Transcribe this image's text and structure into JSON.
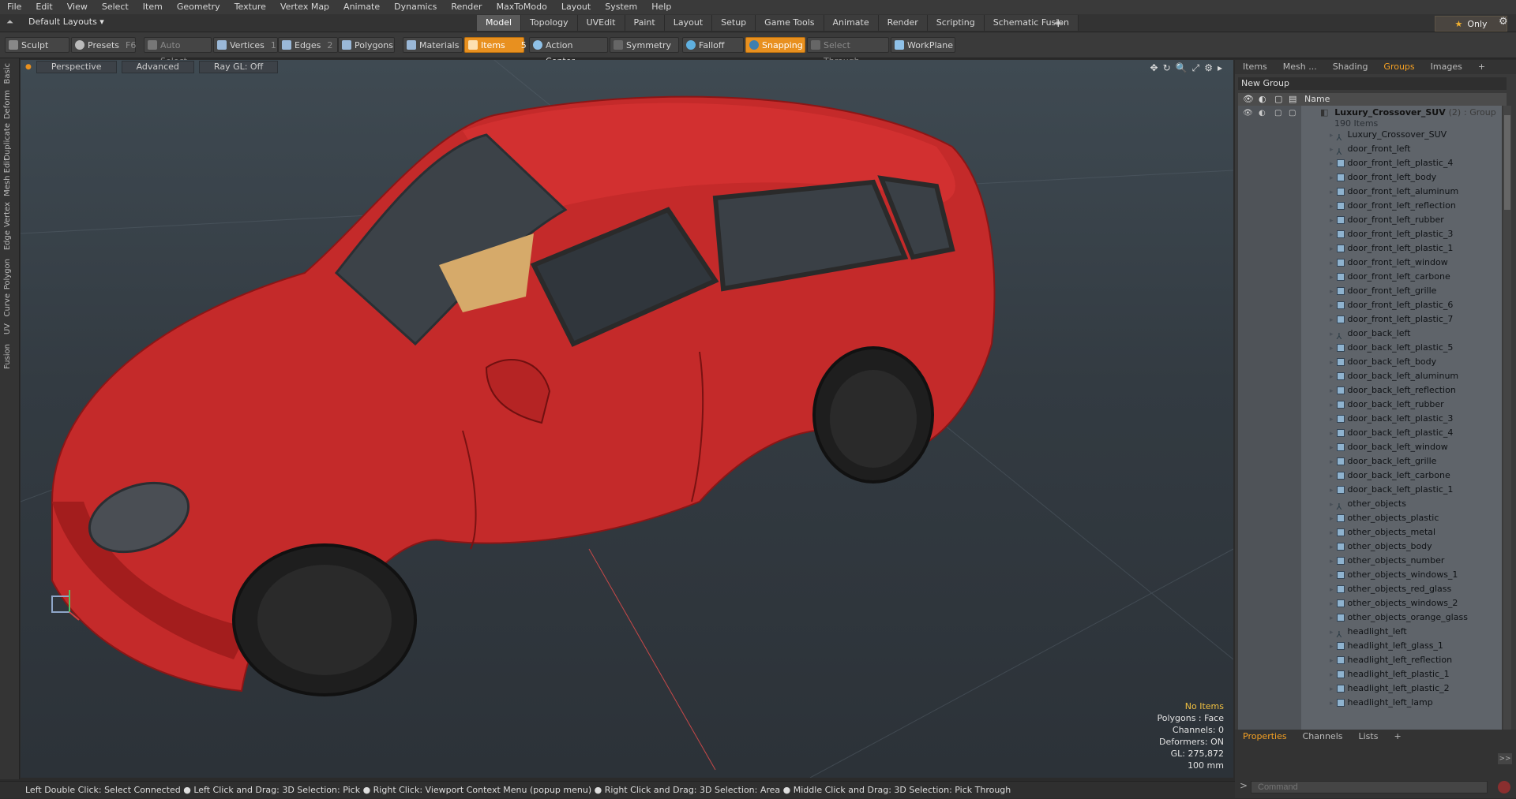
{
  "menu": [
    "File",
    "Edit",
    "View",
    "Select",
    "Item",
    "Geometry",
    "Texture",
    "Vertex Map",
    "Animate",
    "Dynamics",
    "Render",
    "MaxToModo",
    "Layout",
    "System",
    "Help"
  ],
  "layout": {
    "selector": "Default Layouts ▾"
  },
  "tabs": [
    {
      "label": "Model",
      "active": true
    },
    {
      "label": "Topology",
      "active": false
    },
    {
      "label": "UVEdit",
      "active": false
    },
    {
      "label": "Paint",
      "active": false
    },
    {
      "label": "Layout",
      "active": false
    },
    {
      "label": "Setup",
      "active": false
    },
    {
      "label": "Game Tools",
      "active": false
    },
    {
      "label": "Animate",
      "active": false
    },
    {
      "label": "Render",
      "active": false
    },
    {
      "label": "Scripting",
      "active": false
    },
    {
      "label": "Schematic Fusion",
      "active": false
    }
  ],
  "tab_add": "+",
  "only": {
    "label": "Only",
    "star": "★"
  },
  "gear": "⚙",
  "toolbar": {
    "sculpt": "Sculpt",
    "presets": "Presets",
    "presets_key": "F6",
    "auto_select": "Auto Select",
    "vertices": "Vertices",
    "vertices_key": "1",
    "edges": "Edges",
    "edges_key": "2",
    "polygons": "Polygons",
    "materials": "Materials",
    "items": "Items",
    "items_key": "5",
    "action_center": "Action Center",
    "symmetry": "Symmetry",
    "falloff": "Falloff",
    "snapping": "Snapping",
    "select_through": "Select Through",
    "workplane": "WorkPlane"
  },
  "left_tabs": [
    "Basic",
    "Deform",
    "Duplicate",
    "Mesh Edit",
    "Vertex",
    "Edge",
    "Polygon",
    "Curve",
    "UV",
    "Fusion"
  ],
  "viewport": {
    "perspective": "Perspective",
    "advanced": "Advanced",
    "raygl": "Ray GL: Off",
    "icons": [
      "✥",
      "↻",
      "🔍",
      "⤢",
      "⚙",
      "▸"
    ],
    "stats": {
      "no_items": "No Items",
      "polygons": "Polygons : Face",
      "channels": "Channels: 0",
      "deformers": "Deformers: ON",
      "gl": "GL: 275,872",
      "scale": "100 mm"
    }
  },
  "right_panel": {
    "tabs": [
      {
        "label": "Items",
        "active": false
      },
      {
        "label": "Mesh ...",
        "active": false
      },
      {
        "label": "Shading",
        "active": false
      },
      {
        "label": "Groups",
        "active": true
      },
      {
        "label": "Images",
        "active": false
      },
      {
        "label": "+",
        "active": false
      }
    ],
    "new_group": "New Group",
    "column_name": "Name",
    "group": {
      "name": "Luxury_Crossover_SUV",
      "count": "(2)",
      "type": ": Group",
      "items": "190 Items"
    },
    "items": [
      {
        "name": "Luxury_Crossover_SUV",
        "kind": "loc"
      },
      {
        "name": "door_front_left",
        "kind": "loc"
      },
      {
        "name": "door_front_left_plastic_4",
        "kind": "mesh"
      },
      {
        "name": "door_front_left_body",
        "kind": "mesh"
      },
      {
        "name": "door_front_left_aluminum",
        "kind": "mesh"
      },
      {
        "name": "door_front_left_reflection",
        "kind": "mesh"
      },
      {
        "name": "door_front_left_rubber",
        "kind": "mesh"
      },
      {
        "name": "door_front_left_plastic_3",
        "kind": "mesh"
      },
      {
        "name": "door_front_left_plastic_1",
        "kind": "mesh"
      },
      {
        "name": "door_front_left_window",
        "kind": "mesh"
      },
      {
        "name": "door_front_left_carbone",
        "kind": "mesh"
      },
      {
        "name": "door_front_left_grille",
        "kind": "mesh"
      },
      {
        "name": "door_front_left_plastic_6",
        "kind": "mesh"
      },
      {
        "name": "door_front_left_plastic_7",
        "kind": "mesh"
      },
      {
        "name": "door_back_left",
        "kind": "loc"
      },
      {
        "name": "door_back_left_plastic_5",
        "kind": "mesh"
      },
      {
        "name": "door_back_left_body",
        "kind": "mesh"
      },
      {
        "name": "door_back_left_aluminum",
        "kind": "mesh"
      },
      {
        "name": "door_back_left_reflection",
        "kind": "mesh"
      },
      {
        "name": "door_back_left_rubber",
        "kind": "mesh"
      },
      {
        "name": "door_back_left_plastic_3",
        "kind": "mesh"
      },
      {
        "name": "door_back_left_plastic_4",
        "kind": "mesh"
      },
      {
        "name": "door_back_left_window",
        "kind": "mesh"
      },
      {
        "name": "door_back_left_grille",
        "kind": "mesh"
      },
      {
        "name": "door_back_left_carbone",
        "kind": "mesh"
      },
      {
        "name": "door_back_left_plastic_1",
        "kind": "mesh"
      },
      {
        "name": "other_objects",
        "kind": "loc"
      },
      {
        "name": "other_objects_plastic",
        "kind": "mesh"
      },
      {
        "name": "other_objects_metal",
        "kind": "mesh"
      },
      {
        "name": "other_objects_body",
        "kind": "mesh"
      },
      {
        "name": "other_objects_number",
        "kind": "mesh"
      },
      {
        "name": "other_objects_windows_1",
        "kind": "mesh"
      },
      {
        "name": "other_objects_red_glass",
        "kind": "mesh"
      },
      {
        "name": "other_objects_windows_2",
        "kind": "mesh"
      },
      {
        "name": "other_objects_orange_glass",
        "kind": "mesh"
      },
      {
        "name": "headlight_left",
        "kind": "loc"
      },
      {
        "name": "headlight_left_glass_1",
        "kind": "mesh"
      },
      {
        "name": "headlight_left_reflection",
        "kind": "mesh"
      },
      {
        "name": "headlight_left_plastic_1",
        "kind": "mesh"
      },
      {
        "name": "headlight_left_plastic_2",
        "kind": "mesh"
      },
      {
        "name": "headlight_left_lamp",
        "kind": "mesh"
      }
    ]
  },
  "properties": {
    "tabs": [
      {
        "label": "Properties",
        "active": true
      },
      {
        "label": "Channels",
        "active": false
      },
      {
        "label": "Lists",
        "active": false
      },
      {
        "label": "+",
        "active": false
      }
    ],
    "expand": ">>",
    "command_placeholder": "Command",
    "command_arrow": ">"
  },
  "statusbar": "Left Double Click: Select Connected ● Left Click and Drag: 3D Selection: Pick ● Right Click: Viewport Context Menu (popup menu) ● Right Click and Drag: 3D Selection: Area ● Middle Click and Drag: 3D Selection: Pick Through",
  "colors": {
    "accent": "#e8901f",
    "car_body": "#c22a2a",
    "viewport_bg": "#3a434b"
  }
}
